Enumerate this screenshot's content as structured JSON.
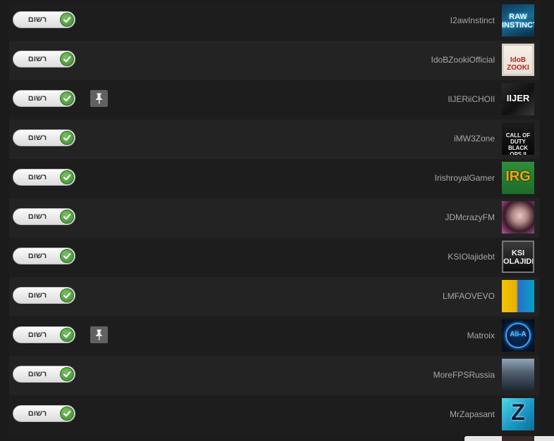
{
  "subscribe_label": "רשום",
  "channels": [
    {
      "name": "I2awInstinct",
      "thumb_text": "RAW INSTINCT",
      "pinned": false
    },
    {
      "name": "IdoBZookiOfficial",
      "thumb_text": "IdoB ZOOKI",
      "pinned": false
    },
    {
      "name": "IlJERiiCHOIl",
      "thumb_text": "IIJER",
      "pinned": true
    },
    {
      "name": "iMW3Zone",
      "thumb_text": "CALL OF DUTY BLACK OPS II",
      "pinned": false
    },
    {
      "name": "IrishroyalGamer",
      "thumb_text": "IRG",
      "pinned": false
    },
    {
      "name": "JDMcrazyFM",
      "thumb_text": "",
      "pinned": false
    },
    {
      "name": "KSIOlajidebt",
      "thumb_text": "KSI OLAJIDEBT",
      "pinned": false
    },
    {
      "name": "LMFAOVEVO",
      "thumb_text": "",
      "pinned": false
    },
    {
      "name": "Matroix",
      "thumb_text": "Ali-A",
      "pinned": true
    },
    {
      "name": "MoreFPSRussia",
      "thumb_text": "",
      "pinned": false
    },
    {
      "name": "MrZapasant",
      "thumb_text": "Z",
      "pinned": false
    }
  ],
  "colors": {
    "background": "#1b1b1b",
    "row_alt": "#232323",
    "name_text": "#a7a7a7",
    "check_green": "#4ea33a",
    "pin_gray": "#616161"
  }
}
